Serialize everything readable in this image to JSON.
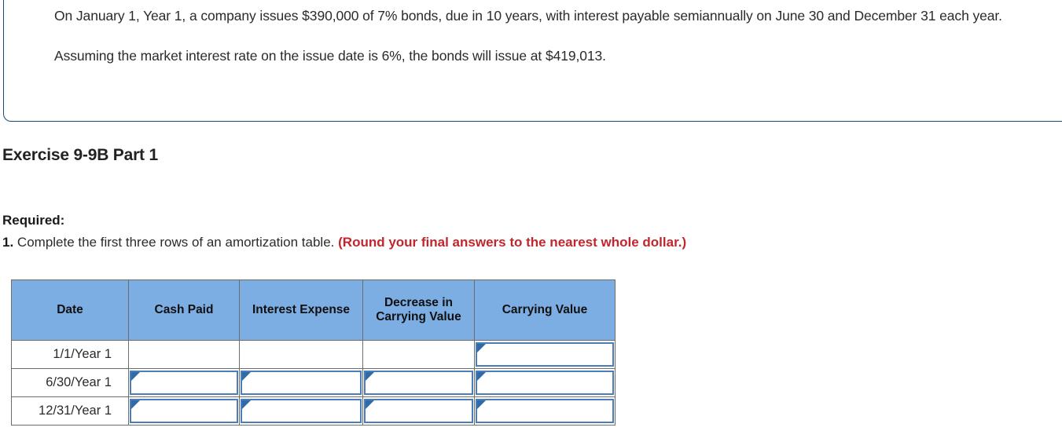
{
  "problem": {
    "paragraphs": [
      "On January 1, Year 1, a company issues $390,000 of 7% bonds, due in 10 years, with interest payable semiannually on June 30 and December 31 each year.",
      "Assuming the market interest rate on the issue date is 6%, the bonds will issue at $419,013."
    ]
  },
  "exercise": {
    "title": "Exercise 9-9B Part 1"
  },
  "required": {
    "label": "Required:",
    "item_number": "1.",
    "item_text": "Complete the first three rows of an amortization table.",
    "round_note": "(Round your final answers to the nearest whole dollar.)"
  },
  "table": {
    "headers": [
      "Date",
      "Cash Paid",
      "Interest Expense",
      "Decrease in Carrying Value",
      "Carrying Value"
    ],
    "rows": [
      {
        "date": "1/1/Year 1",
        "cash_paid": "",
        "interest_expense": "",
        "decrease_in_carrying_value": "",
        "carrying_value": ""
      },
      {
        "date": "6/30/Year 1",
        "cash_paid": "",
        "interest_expense": "",
        "decrease_in_carrying_value": "",
        "carrying_value": ""
      },
      {
        "date": "12/31/Year 1",
        "cash_paid": "",
        "interest_expense": "",
        "decrease_in_carrying_value": "",
        "carrying_value": ""
      }
    ]
  },
  "colors": {
    "header_blue": "#7CAEE4",
    "input_border_blue": "#4A7EBB",
    "panel_border_blue": "#124a80",
    "note_red": "#c1262d"
  }
}
